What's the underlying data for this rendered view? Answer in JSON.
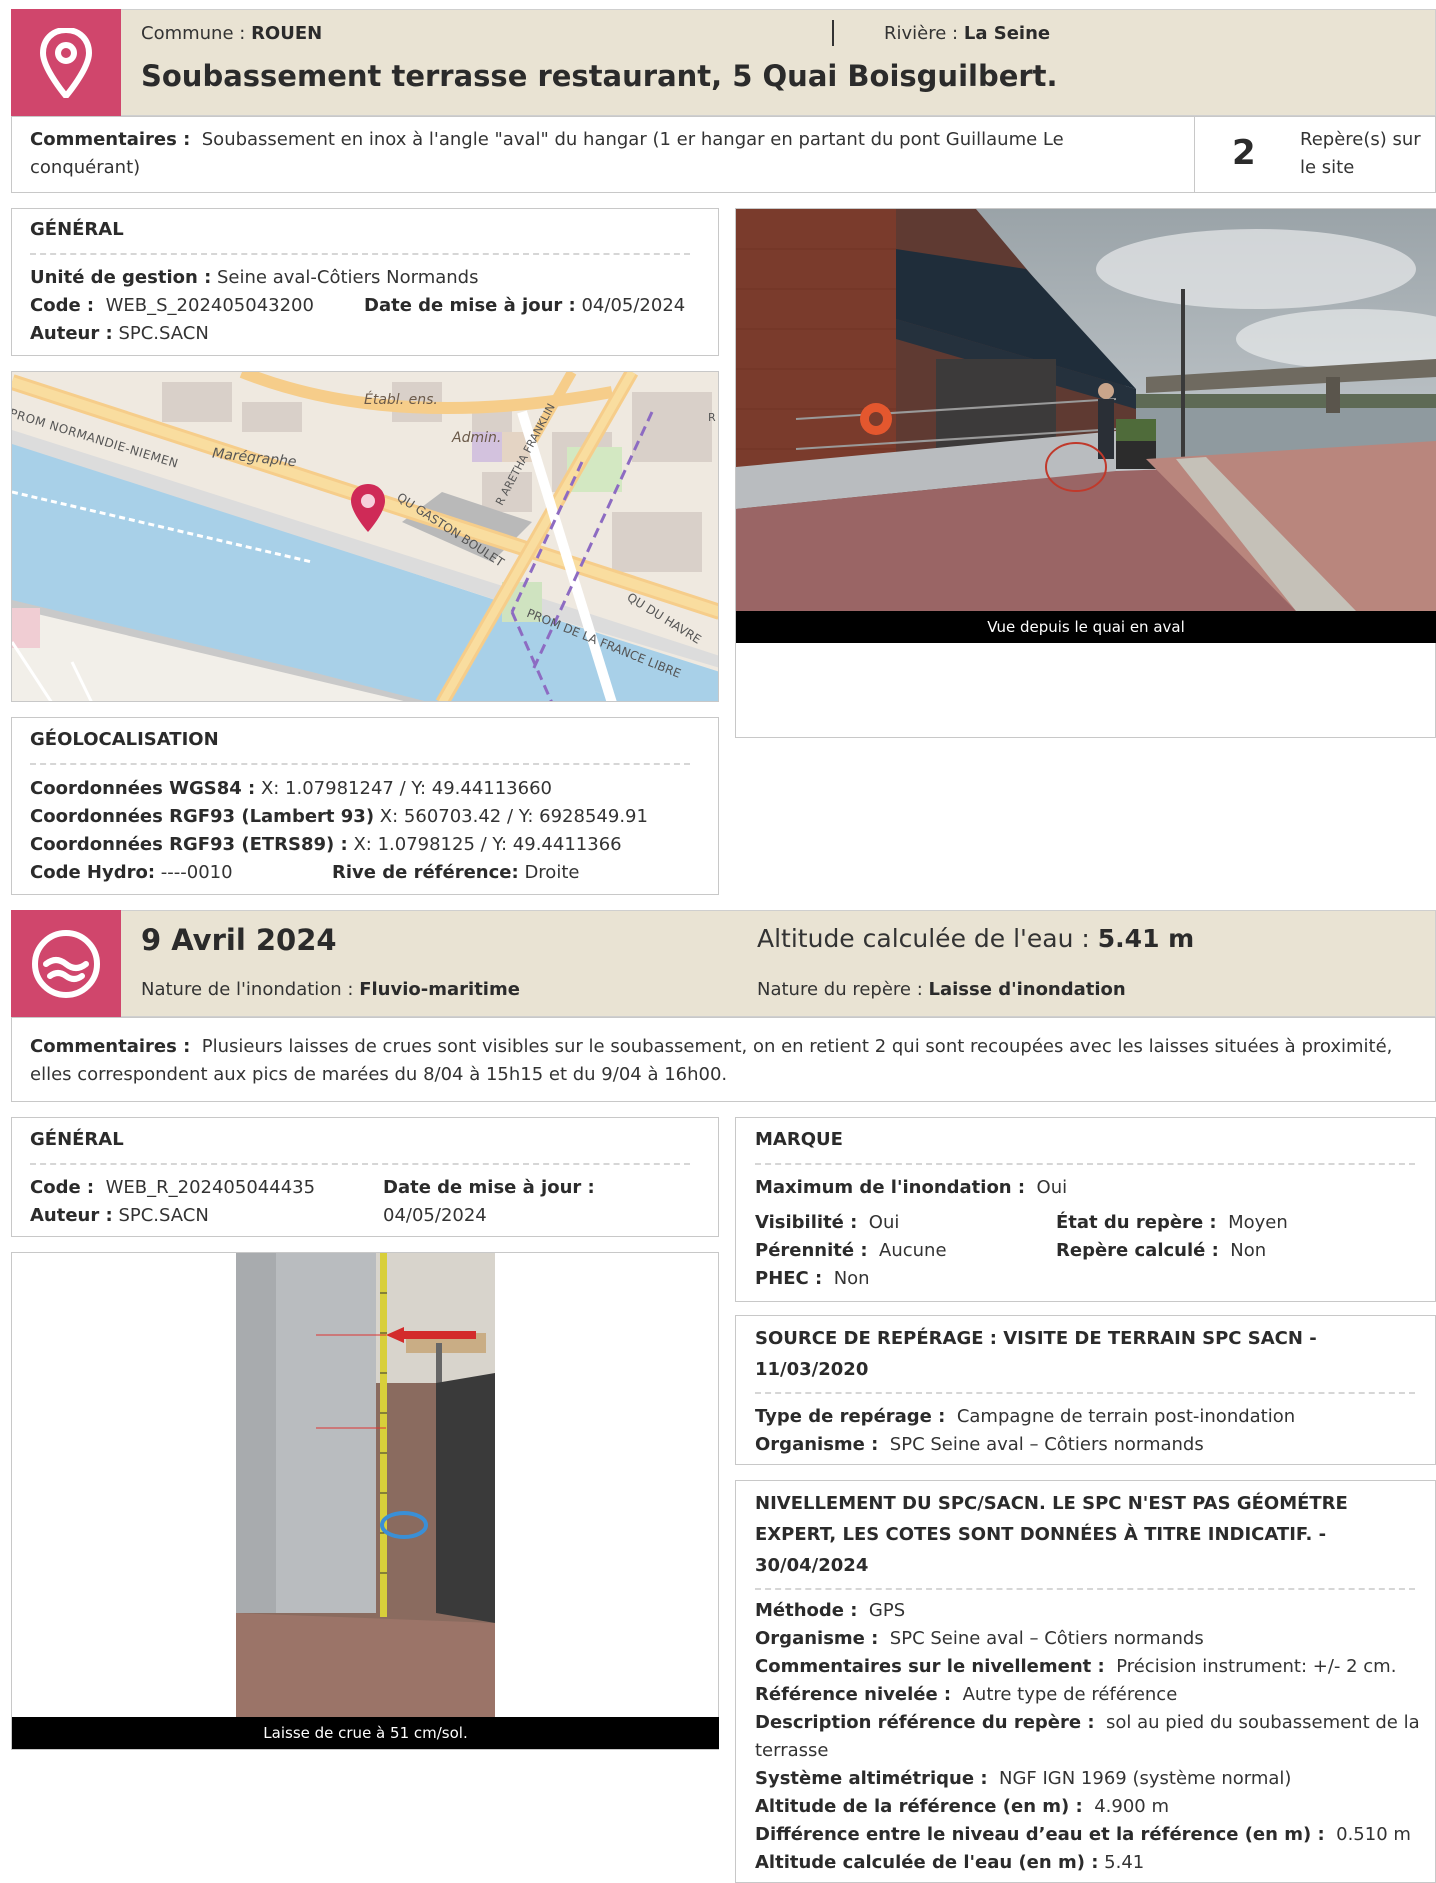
{
  "header": {
    "commune_label": "Commune :",
    "commune": "ROUEN",
    "riviere_label": "Rivière :",
    "riviere": "La Seine",
    "title": "Soubassement terrasse restaurant, 5 Quai Boisguilbert."
  },
  "site_comment": {
    "label": "Commentaires :",
    "text": "Soubassement en inox à l'angle \"aval\" du hangar (1 er hangar en partant du pont Guillaume Le conquérant)",
    "count": "2",
    "count_label": "Repère(s) sur le site"
  },
  "general": {
    "title": "GÉNÉRAL",
    "unite_label": "Unité de gestion :",
    "unite": "Seine aval-Côtiers Normands",
    "code_label": "Code :",
    "code": "WEB_S_202405043200",
    "date_label": "Date de mise à jour :",
    "date": "04/05/2024",
    "auteur_label": "Auteur :",
    "auteur": "SPC.SACN"
  },
  "map": {
    "labels": {
      "prom_normandie": "PROM NORMANDIE-NIEMEN",
      "maregraphe": "Marégraphe",
      "etabl": "Établ. ens.",
      "admin": "Admin.",
      "aretha": "R ARETHA FRANKLIN",
      "gaston": "QU GASTON BOULET",
      "havre": "QU DU HAVRE",
      "prom_france": "PROM DE LA FRANCE LIBRE",
      "r": "R"
    },
    "pin": "map-pin-icon"
  },
  "photo1": {
    "caption": "Vue depuis le quai en aval"
  },
  "geoloc": {
    "title": "GÉOLOCALISATION",
    "wgs_label": "Coordonnées WGS84 :",
    "wgs": "X: 1.07981247 / Y: 49.44113660",
    "lambert_label": "Coordonnées RGF93 (Lambert 93)",
    "lambert": "X: 560703.42 / Y: 6928549.91",
    "etrs_label": "Coordonnées RGF93 (ETRS89) :",
    "etrs": "X: 1.0798125 / Y: 49.4411366",
    "hydro_label": "Code Hydro:",
    "hydro": "----0010",
    "rive_label": "Rive de référence:",
    "rive": "Droite"
  },
  "event": {
    "date": "9 Avril 2024",
    "alt_label": "Altitude calculée de l'eau :",
    "alt": "5.41 m",
    "nature_label": "Nature de l'inondation :",
    "nature": "Fluvio-maritime",
    "repere_label": "Nature du repère :",
    "repere": "Laisse d'inondation",
    "comment_label": "Commentaires :",
    "comment": "Plusieurs laisses de crues sont visibles sur le soubassement, on en retient 2 qui sont recoupées avec les laisses situées à proximité, elles correspondent aux pics de marées du 8/04 à 15h15 et du 9/04 à 16h00."
  },
  "general2": {
    "title": "GÉNÉRAL",
    "code_label": "Code :",
    "code": "WEB_R_202405044435",
    "date_label": "Date de mise à jour :",
    "date": "04/05/2024",
    "auteur_label": "Auteur :",
    "auteur": "SPC.SACN"
  },
  "photo2": {
    "caption": "Laisse de crue à 51 cm/sol."
  },
  "marque": {
    "title": "MARQUE",
    "max_label": "Maximum de l'inondation :",
    "max": "Oui",
    "vis_label": "Visibilité :",
    "vis": "Oui",
    "etat_label": "État du repère :",
    "etat": "Moyen",
    "per_label": "Pérennité :",
    "per": "Aucune",
    "calc_label": "Repère calculé :",
    "calc": "Non",
    "phec_label": "PHEC :",
    "phec": "Non"
  },
  "source": {
    "title": "SOURCE DE REPÉRAGE : VISITE DE TERRAIN SPC SACN - 11/03/2020",
    "type_label": "Type de repérage :",
    "type": "Campagne de terrain post-inondation",
    "org_label": "Organisme :",
    "org": "SPC Seine aval – Côtiers normands"
  },
  "nivellement": {
    "title": "NIVELLEMENT DU SPC/SACN. LE SPC N'EST PAS GÉOMÉTRE EXPERT, LES COTES SONT DONNÉES À TITRE INDICATIF. - 30/04/2024",
    "methode_label": "Méthode :",
    "methode": "GPS",
    "org_label": "Organisme :",
    "org": "SPC Seine aval – Côtiers normands",
    "comm_label": "Commentaires sur le nivellement :",
    "comm": "Précision instrument: +/- 2 cm.",
    "ref_label": "Référence nivelée :",
    "ref": "Autre type de référence",
    "desc_label": "Description référence du repère :",
    "desc": "sol au pied du soubassement de la terrasse",
    "sys_label": "Système altimétrique :",
    "sys": "NGF IGN 1969 (système normal)",
    "altref_label": "Altitude de la référence (en m) :",
    "altref": "4.900 m",
    "diff_label": "Différence entre le niveau d’eau et la référence (en m) :",
    "diff": "0.510 m",
    "alteau_label": "Altitude calculée de l'eau (en m) :",
    "alteau": "5.41"
  }
}
